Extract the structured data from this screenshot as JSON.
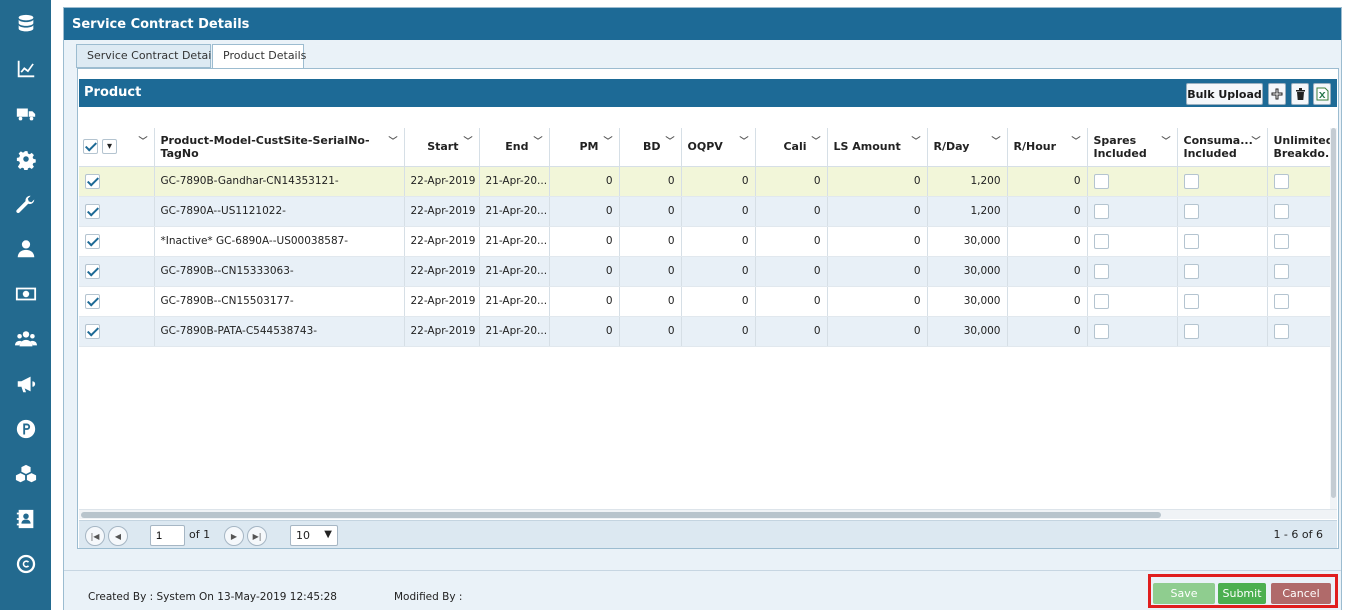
{
  "sidebar": {
    "icons": [
      "database-icon",
      "chart-line-icon",
      "truck-icon",
      "gear-icon",
      "wrench-icon",
      "user-icon",
      "money-icon",
      "users-icon",
      "megaphone-icon",
      "parking-icon",
      "cubes-icon",
      "address-book-icon",
      "copyright-icon"
    ]
  },
  "window": {
    "title": "Service Contract Details"
  },
  "tabs": [
    {
      "label": "Service Contract Details"
    },
    {
      "label": "Product Details"
    }
  ],
  "product": {
    "title": "Product",
    "bulk_upload_label": "Bulk Upload"
  },
  "table": {
    "columns": [
      "Product-Model-CustSite-SerialNo-TagNo",
      "Start",
      "End",
      "PM",
      "BD",
      "OQPV",
      "Cali",
      "LS Amount",
      "R/Day",
      "R/Hour",
      "Spares Included",
      "Consuma... Included",
      "Unlimited Breakdo..."
    ],
    "rows": [
      {
        "product": "GC-7890B-Gandhar-CN14353121-",
        "start": "22-Apr-2019",
        "end": "21-Apr-20...",
        "pm": "0",
        "bd": "0",
        "oqpv": "0",
        "cali": "0",
        "ls": "0",
        "rday": "1,200",
        "rhour": "0"
      },
      {
        "product": "GC-7890A--US1121022-",
        "start": "22-Apr-2019",
        "end": "21-Apr-20...",
        "pm": "0",
        "bd": "0",
        "oqpv": "0",
        "cali": "0",
        "ls": "0",
        "rday": "1,200",
        "rhour": "0"
      },
      {
        "product": "*Inactive* GC-6890A--US00038587-",
        "start": "22-Apr-2019",
        "end": "21-Apr-20...",
        "pm": "0",
        "bd": "0",
        "oqpv": "0",
        "cali": "0",
        "ls": "0",
        "rday": "30,000",
        "rhour": "0"
      },
      {
        "product": "GC-7890B--CN15333063-",
        "start": "22-Apr-2019",
        "end": "21-Apr-20...",
        "pm": "0",
        "bd": "0",
        "oqpv": "0",
        "cali": "0",
        "ls": "0",
        "rday": "30,000",
        "rhour": "0"
      },
      {
        "product": "GC-7890B--CN15503177-",
        "start": "22-Apr-2019",
        "end": "21-Apr-20...",
        "pm": "0",
        "bd": "0",
        "oqpv": "0",
        "cali": "0",
        "ls": "0",
        "rday": "30,000",
        "rhour": "0"
      },
      {
        "product": "GC-7890B-PATA-C544538743-",
        "start": "22-Apr-2019",
        "end": "21-Apr-20...",
        "pm": "0",
        "bd": "0",
        "oqpv": "0",
        "cali": "0",
        "ls": "0",
        "rday": "30,000",
        "rhour": "0"
      }
    ]
  },
  "pager": {
    "page": "1",
    "of_label": "of 1",
    "page_size": "10",
    "summary": "1 - 6 of 6"
  },
  "footer": {
    "created_by": "Created By : System On 13-May-2019 12:45:28",
    "modified_by": "Modified By :",
    "save_label": "Save",
    "submit_label": "Submit",
    "cancel_label": "Cancel"
  },
  "colors": {
    "header_blue": "#1d6a96",
    "sidebar_blue": "#236a8f",
    "save_green": "#8fcd8f",
    "submit_green": "#4caf50",
    "cancel_red": "#b06a6a",
    "highlight_red": "#e01e1e"
  }
}
